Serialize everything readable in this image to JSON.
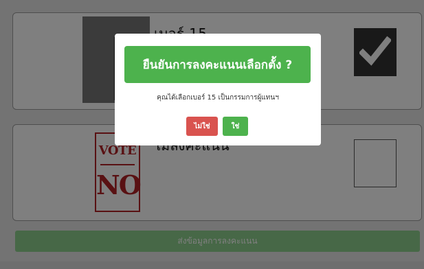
{
  "ballot": {
    "candidate": {
      "name": "เบอร์ 15",
      "checked": true
    },
    "abstain": {
      "badge_top": "VOTE",
      "badge_bottom": "NO",
      "label": "ไม่ลงคะแนน",
      "checked": false
    },
    "submit_label": "ส่งข้อมูลการลงคะแนน"
  },
  "modal": {
    "title": "ยืนยันการลงคะแนนเลือกตั้ง ?",
    "message": "คุณได้เลือกเบอร์ 15 เป็นกรรมการผู้แทนฯ",
    "no_label": "ไม่ใช่",
    "yes_label": "ใช่"
  },
  "colors": {
    "accent_green": "#4db24d",
    "danger_red": "#d9534f",
    "vote_no_red": "#b32227",
    "overlay": "rgba(0,0,0,0.5)"
  },
  "icons": {
    "checkbox_checked": "checkmark-icon"
  }
}
